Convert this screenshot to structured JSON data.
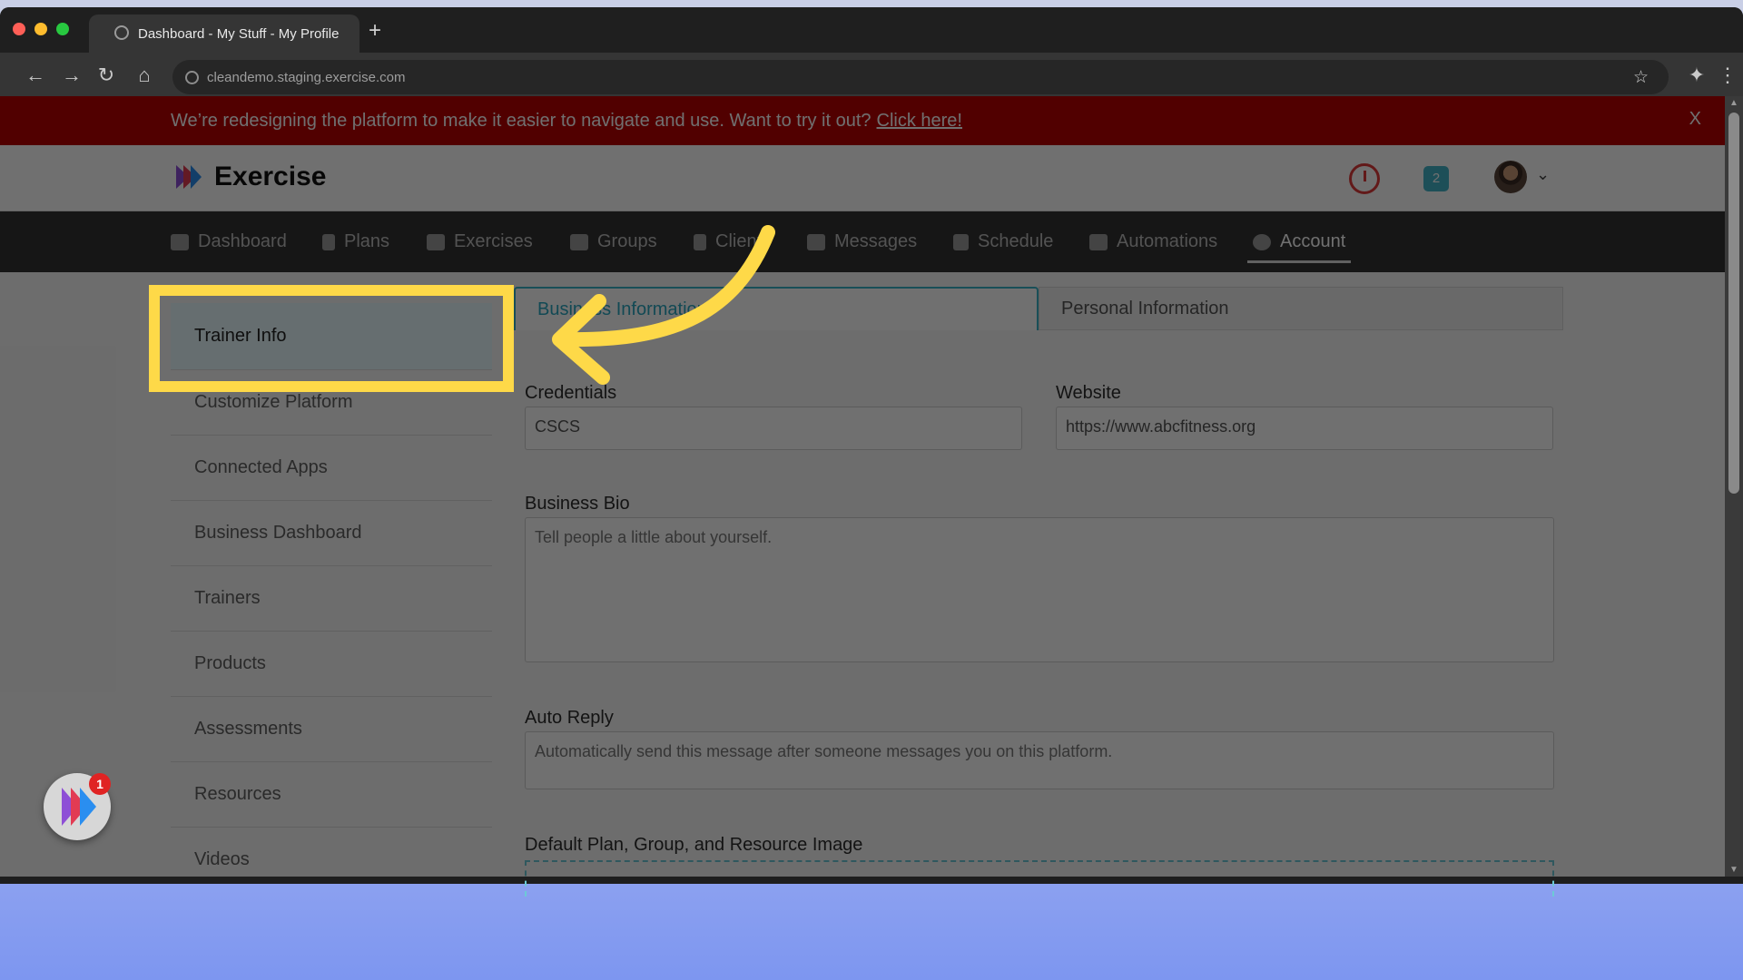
{
  "browser": {
    "tab_title": "Dashboard - My Stuff - My Profile",
    "new_tab_icon": "plus-icon",
    "url": "cleandemo.staging.exercise.com"
  },
  "banner": {
    "message": "We’re redesigning the platform to make it easier to navigate and use. Want to try it out?",
    "link_label": "Click here!",
    "close_label": "X",
    "color": "#b80000"
  },
  "header": {
    "brand": "Exercise",
    "notification_count": "2"
  },
  "nav": [
    {
      "label": "Dashboard",
      "icon": "list-icon"
    },
    {
      "label": "Plans",
      "icon": "clipboard-icon"
    },
    {
      "label": "Exercises",
      "icon": "dumbbell-icon"
    },
    {
      "label": "Groups",
      "icon": "users-icon"
    },
    {
      "label": "Clients",
      "icon": "user-icon"
    },
    {
      "label": "Messages",
      "icon": "envelope-icon"
    },
    {
      "label": "Schedule",
      "icon": "book-icon"
    },
    {
      "label": "Automations",
      "icon": "check-square-icon"
    },
    {
      "label": "Account",
      "icon": "user-circle-icon",
      "active": true
    }
  ],
  "sidebar": [
    {
      "label": "Trainer Info",
      "active": true
    },
    {
      "label": "Customize Platform"
    },
    {
      "label": "Connected Apps"
    },
    {
      "label": "Business Dashboard"
    },
    {
      "label": "Trainers"
    },
    {
      "label": "Products"
    },
    {
      "label": "Assessments"
    },
    {
      "label": "Resources"
    },
    {
      "label": "Videos"
    }
  ],
  "tabs": {
    "business": "Business Information",
    "personal": "Personal Information"
  },
  "form": {
    "credentials_label": "Credentials",
    "credentials_value": "CSCS",
    "website_label": "Website",
    "website_value": "https://www.abcfitness.org",
    "bio_label": "Business Bio",
    "bio_placeholder": "Tell people a little about yourself.",
    "auto_reply_label": "Auto Reply",
    "auto_reply_placeholder": "Automatically send this message after someone messages you on this platform.",
    "image_label": "Default Plan, Group, and Resource Image"
  },
  "fab": {
    "badge": "1"
  },
  "colors": {
    "accent": "#3ab3c9",
    "highlight": "#fed948"
  }
}
